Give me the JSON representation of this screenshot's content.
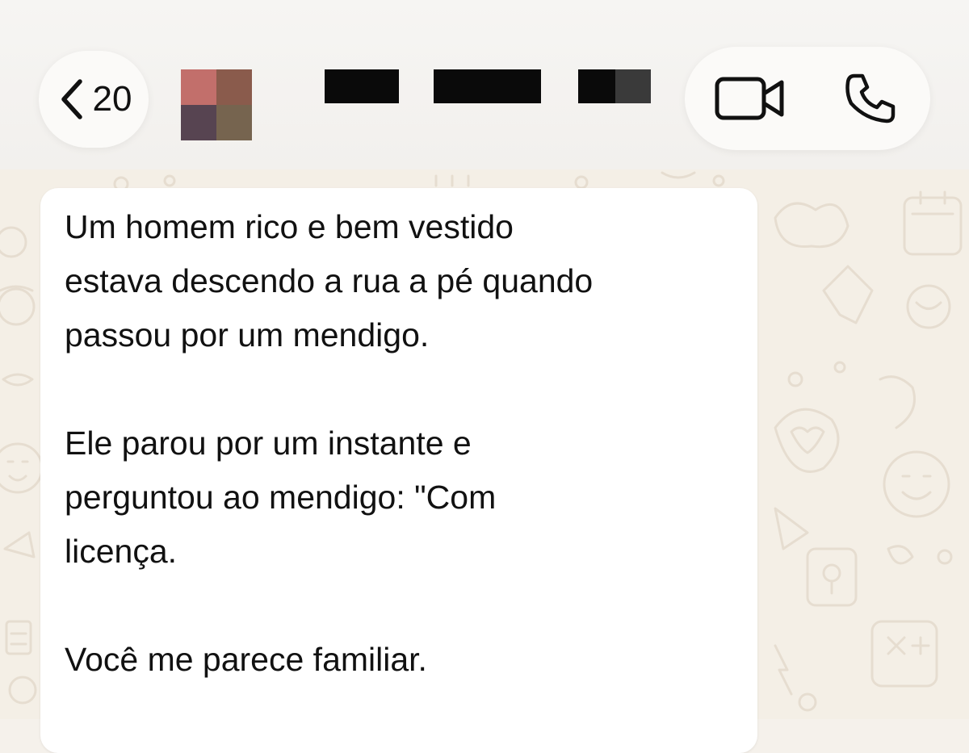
{
  "header": {
    "back_count": "20",
    "icons": {
      "back": "chevron-left-icon",
      "video": "video-camera-icon",
      "phone": "phone-icon"
    }
  },
  "message": {
    "paragraphs": [
      "Um homem rico e bem vestido\nestava descendo a rua a pé quando\npassou por um mendigo.",
      "Ele parou por um instante e\nperguntou ao mendigo: \"Com\nlicença.",
      "Você me parece familiar."
    ]
  },
  "colors": {
    "chat_background": "#f4efe6",
    "bubble": "#ffffff",
    "text": "#111111"
  }
}
